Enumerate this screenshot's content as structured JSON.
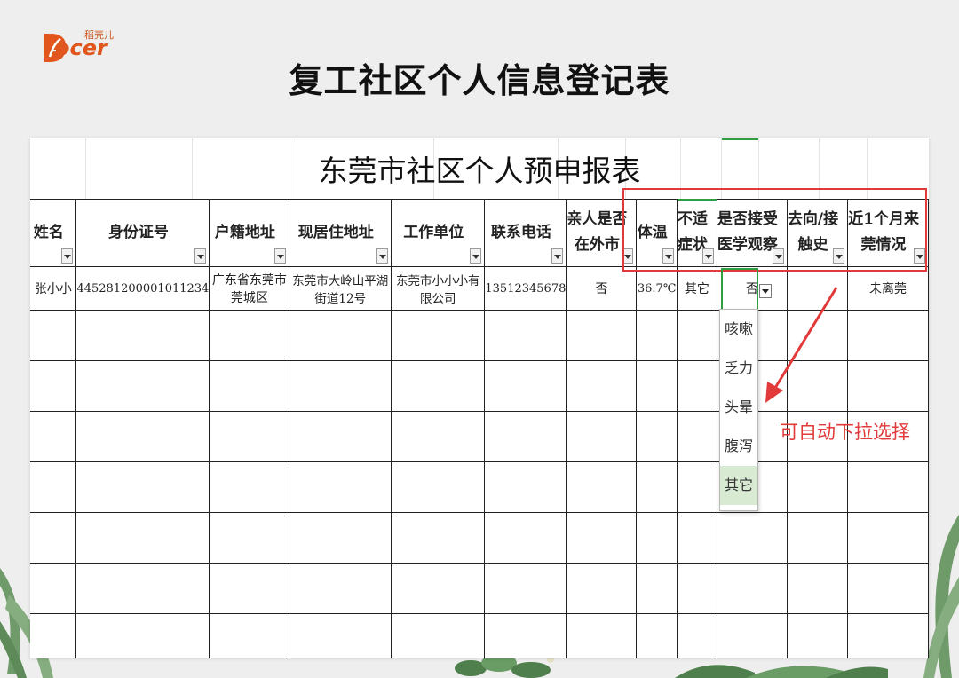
{
  "logo": {
    "tagline": "稻壳儿",
    "wordmark": "ocer"
  },
  "page_title": "复工社区个人信息登记表",
  "sheet": {
    "title": "东莞市社区个人预申报表",
    "headers": [
      {
        "line1": "姓名",
        "line2": ""
      },
      {
        "line1": "身份证号",
        "line2": ""
      },
      {
        "line1": "户籍地址",
        "line2": ""
      },
      {
        "line1": "现居住地址",
        "line2": ""
      },
      {
        "line1": "工作单位",
        "line2": ""
      },
      {
        "line1": "联系电话",
        "line2": ""
      },
      {
        "line1": "亲人是否",
        "line2": "在外市"
      },
      {
        "line1": "体温",
        "line2": ""
      },
      {
        "line1": "不适",
        "line2": "症状"
      },
      {
        "line1": "是否接受",
        "line2": "医学观察"
      },
      {
        "line1": "去向/接",
        "line2": "触史"
      },
      {
        "line1": "近1个月来",
        "line2": "莞情况"
      }
    ],
    "row": [
      "张小小",
      "445281200001011234",
      "广东省东莞市莞城区",
      "东莞市大岭山平湖街道12号",
      "东莞市小小小有限公司",
      "13512345678",
      "否",
      "36.7℃",
      "其它",
      "否",
      "",
      "未离莞"
    ],
    "dropdown_options": [
      "咳嗽",
      "乏力",
      "头晕",
      "腹泻",
      "其它"
    ],
    "dropdown_selected": "其它"
  },
  "annotation": "可自动下拉选择",
  "colors": {
    "accent_red": "#e23a3a",
    "excel_green": "#2e9e3e",
    "logo_orange": "#e0561c"
  }
}
